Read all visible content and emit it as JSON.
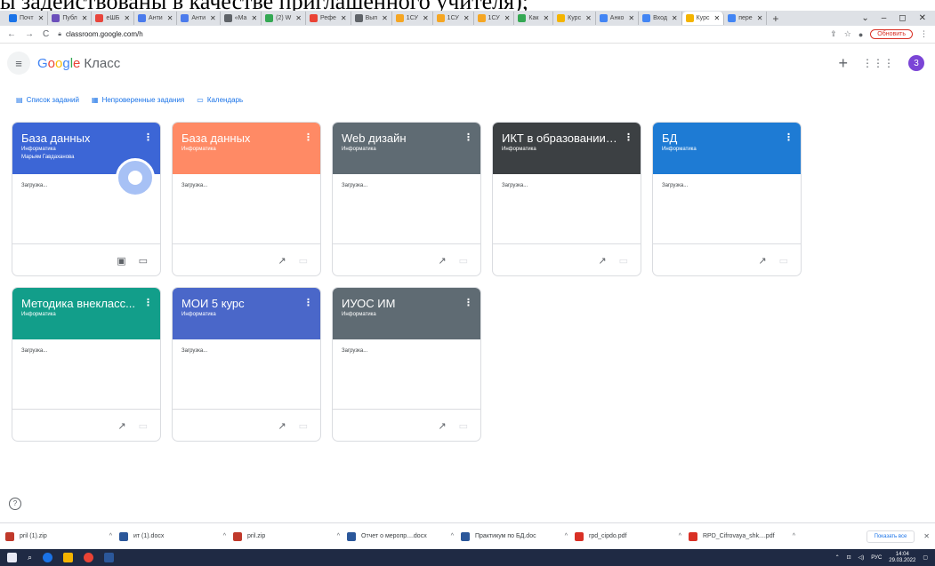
{
  "doc_strip": "ы задействованы в качестве приглашенного учителя);",
  "browser": {
    "tabs": [
      {
        "label": "Почт",
        "color": "#1a73e8"
      },
      {
        "label": "Публ",
        "color": "#6b4fbb"
      },
      {
        "label": "еШБ",
        "color": "#e8453c"
      },
      {
        "label": "Анти",
        "color": "#4b7bec"
      },
      {
        "label": "Анти",
        "color": "#4b7bec"
      },
      {
        "label": "«Ма",
        "color": "#5f6368"
      },
      {
        "label": "(2) W",
        "color": "#34a853"
      },
      {
        "label": "Рефе",
        "color": "#ea4335"
      },
      {
        "label": "Вып",
        "color": "#5f6368"
      },
      {
        "label": "1СУ",
        "color": "#f5a623"
      },
      {
        "label": "1СУ",
        "color": "#f5a623"
      },
      {
        "label": "1СУ",
        "color": "#f5a623"
      },
      {
        "label": "Как",
        "color": "#34a853"
      },
      {
        "label": "Курс",
        "color": "#f4b400"
      },
      {
        "label": "Анко",
        "color": "#4285f4"
      },
      {
        "label": "Вход",
        "color": "#4285f4"
      },
      {
        "label": "Курс",
        "color": "#f4b400",
        "active": true
      },
      {
        "label": "пере",
        "color": "#4285f4"
      }
    ],
    "url": "classroom.google.com/h",
    "update_label": "Обновить"
  },
  "app": {
    "brand_google": [
      "G",
      "o",
      "o",
      "g",
      "l",
      "e"
    ],
    "brand_suffix": "Класс",
    "avatar_letter": "3"
  },
  "links": [
    {
      "label": "Список заданий",
      "icon": "list-icon"
    },
    {
      "label": "Непроверенные задания",
      "icon": "grid-icon"
    },
    {
      "label": "Календарь",
      "icon": "calendar-icon"
    }
  ],
  "cards": [
    {
      "title": "База данных",
      "subject": "Информатика",
      "owner": "Марьям Гавдаханова",
      "status": "Загрузка...",
      "color": "#3c66d6"
    },
    {
      "title": "База данных",
      "subject": "Информатика",
      "owner": "",
      "status": "Загрузка...",
      "color": "#ff8a65"
    },
    {
      "title": "Web дизайн",
      "subject": "Информатика",
      "owner": "",
      "status": "Загрузка...",
      "color": "#5f6b73"
    },
    {
      "title": "ИКТ в образовании ...",
      "subject": "Информатика",
      "owner": "",
      "status": "Загрузка...",
      "color": "#3c4043"
    },
    {
      "title": "БД",
      "subject": "Информатика",
      "owner": "",
      "status": "Загрузка...",
      "color": "#1e7bd4"
    },
    {
      "title": "Методика внекласс...",
      "subject": "Информатика",
      "owner": "",
      "status": "Загрузка...",
      "color": "#129e8a"
    },
    {
      "title": "МОИ 5 курс",
      "subject": "Информатика",
      "owner": "",
      "status": "Загрузка...",
      "color": "#4a67c9"
    },
    {
      "title": "ИУОС ИМ",
      "subject": "Информатика",
      "owner": "",
      "status": "Загрузка...",
      "color": "#5f6b73"
    }
  ],
  "downloads": [
    {
      "name": "pril (1).zip",
      "color": "#c0392b"
    },
    {
      "name": "ит (1).docx",
      "color": "#2b579a"
    },
    {
      "name": "pril.zip",
      "color": "#c0392b"
    },
    {
      "name": "Отчет о меропр....docx",
      "color": "#2b579a"
    },
    {
      "name": "Практикум по БД.doc",
      "color": "#2b579a"
    },
    {
      "name": "rpd_cipdo.pdf",
      "color": "#d93025"
    },
    {
      "name": "RPD_Cifrovaya_shk....pdf",
      "color": "#d93025"
    }
  ],
  "show_all_label": "Показать все",
  "taskbar": {
    "lang": "РУС",
    "time": "14:04",
    "date": "29.03.2022"
  }
}
